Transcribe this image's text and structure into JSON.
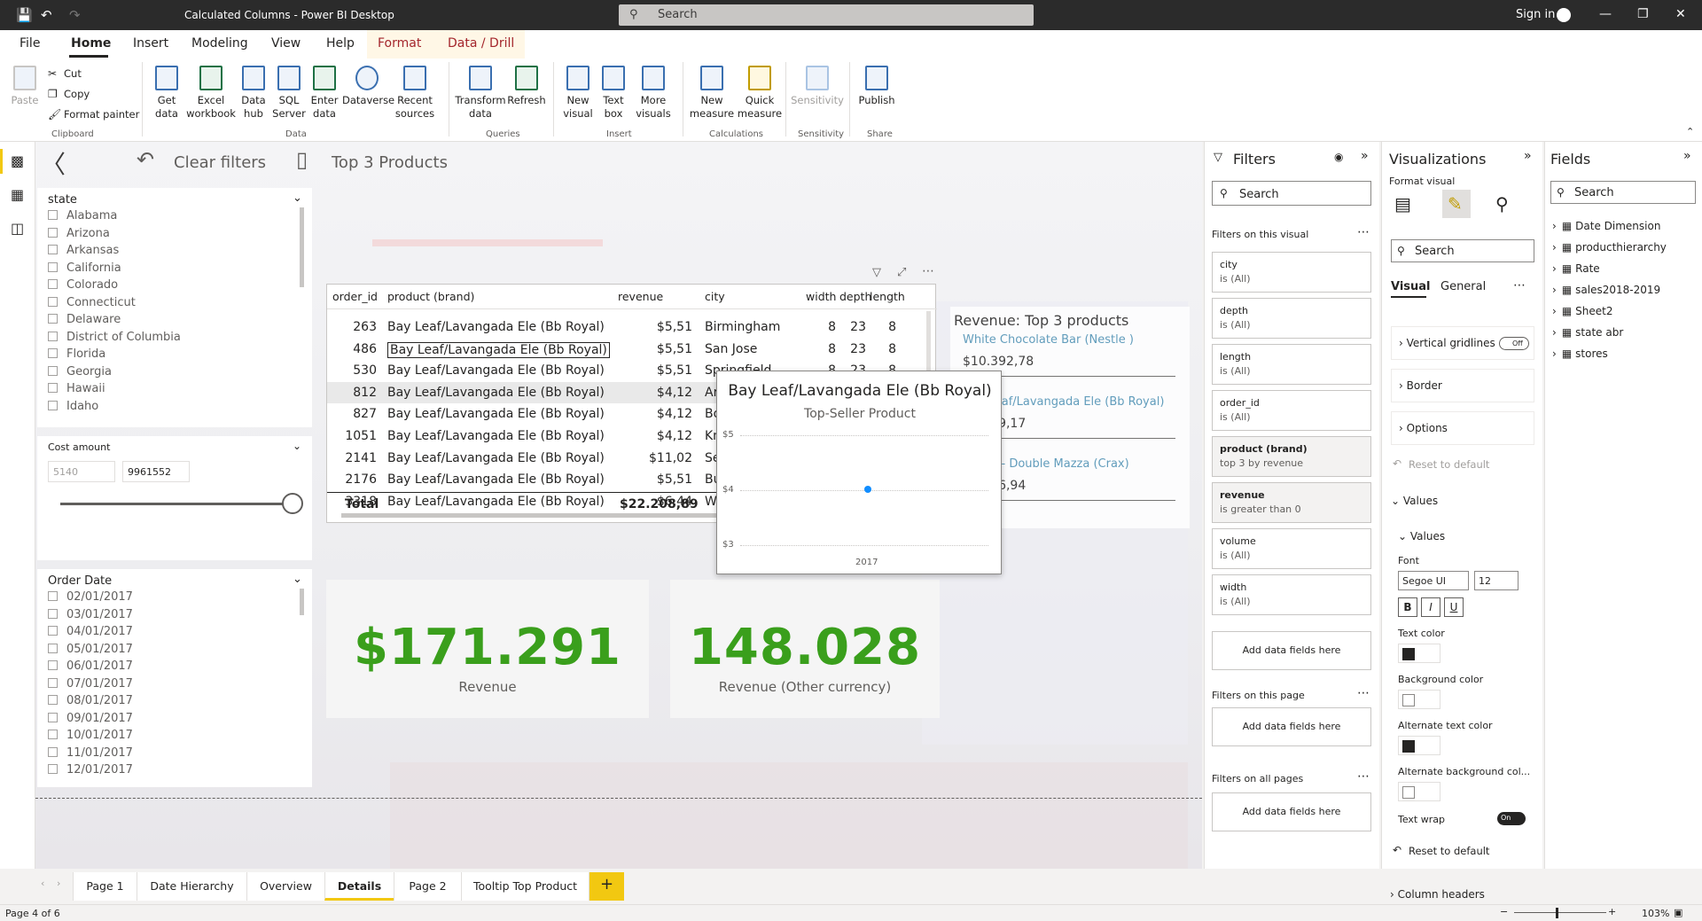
{
  "app": {
    "window_title": "Calculated Columns - Power BI Desktop",
    "search_placeholder": "Search",
    "sign_in": "Sign in"
  },
  "menu": [
    "File",
    "Home",
    "Insert",
    "Modeling",
    "View",
    "Help",
    "Format",
    "Data / Drill"
  ],
  "ribbon": {
    "clipboard": {
      "paste": "Paste",
      "cut": "Cut",
      "copy": "Copy",
      "format_painter": "Format painter",
      "group": "Clipboard"
    },
    "data": {
      "get_data": "Get data",
      "excel": "Excel workbook",
      "data_hub": "Data hub",
      "sql": "SQL Server",
      "enter_data": "Enter data",
      "dataverse": "Dataverse",
      "recent": "Recent sources",
      "group": "Data"
    },
    "queries": {
      "transform": "Transform data",
      "refresh": "Refresh",
      "group": "Queries"
    },
    "insert": {
      "new_visual": "New visual",
      "text_box": "Text box",
      "more_visuals": "More visuals",
      "group": "Insert"
    },
    "calculations": {
      "new_measure": "New measure",
      "quick_measure": "Quick measure",
      "group": "Calculations"
    },
    "sensitivity": {
      "label": "Sensitivity",
      "group": "Sensitivity"
    },
    "share": {
      "publish": "Publish",
      "group": "Share"
    }
  },
  "canvas": {
    "clear_filters": "Clear filters",
    "bookmark_label": "Top 3 Products",
    "state_slicer": {
      "title": "state",
      "items": [
        "Alabama",
        "Arizona",
        "Arkansas",
        "California",
        "Colorado",
        "Connecticut",
        "Delaware",
        "District of Columbia",
        "Florida",
        "Georgia",
        "Hawaii",
        "Idaho"
      ]
    },
    "cost_slicer": {
      "title": "Cost amount",
      "min": "5140",
      "max": "9961552"
    },
    "date_slicer": {
      "title": "Order Date",
      "items": [
        "02/01/2017",
        "03/01/2017",
        "04/01/2017",
        "05/01/2017",
        "06/01/2017",
        "07/01/2017",
        "08/01/2017",
        "09/01/2017",
        "10/01/2017",
        "11/01/2017",
        "12/01/2017"
      ]
    },
    "table": {
      "headers": [
        "order_id",
        "product (brand)",
        "revenue",
        "city",
        "width",
        "depth",
        "length"
      ],
      "rows": [
        [
          "263",
          "Bay Leaf/Lavangada Ele (Bb Royal)",
          "$5,51",
          "Birmingham",
          "8",
          "23",
          "8"
        ],
        [
          "486",
          "Bay Leaf/Lavangada Ele (Bb Royal)",
          "$5,51",
          "San Jose",
          "8",
          "23",
          "8"
        ],
        [
          "530",
          "Bay Leaf/Lavangada Ele (Bb Royal)",
          "$5,51",
          "Springfield",
          "8",
          "23",
          "8"
        ],
        [
          "812",
          "Bay Leaf/Lavangada Ele (Bb Royal)",
          "$4,12",
          "Arlington",
          "",
          "",
          ""
        ],
        [
          "827",
          "Bay Leaf/Lavangada Ele (Bb Royal)",
          "$4,12",
          "Boston",
          "",
          "",
          ""
        ],
        [
          "1051",
          "Bay Leaf/Lavangada Ele (Bb Royal)",
          "$4,12",
          "Knoxville",
          "",
          "",
          ""
        ],
        [
          "2141",
          "Bay Leaf/Lavangada Ele (Bb Royal)",
          "$11,02",
          "Seattle",
          "",
          "",
          ""
        ],
        [
          "2176",
          "Bay Leaf/Lavangada Ele (Bb Royal)",
          "$5,51",
          "Buffalo",
          "",
          "",
          ""
        ],
        [
          "3318",
          "Bay Leaf/Lavangada Ele (Bb Royal)",
          "$6,44",
          "Wichita",
          "",
          "",
          ""
        ]
      ],
      "total_label": "Total",
      "total_value": "$22.208,89"
    },
    "top3": {
      "title": "Revenue: Top 3 products",
      "items": [
        {
          "name": "White Chocolate Bar (Nestle )",
          "value": "$10.392,78"
        },
        {
          "name": "Bay Leaf/Lavangada Ele (Bb Royal)",
          "value": "$9.109,17"
        },
        {
          "name": "Green - Double Mazza (Crax)",
          "value": "$6.776,94"
        }
      ]
    },
    "tooltip": {
      "title": "Bay Leaf/Lavangada Ele (Bb Royal)",
      "subtitle": "Top-Seller Product",
      "y_ticks": [
        "$5",
        "$4",
        "$3"
      ],
      "x_tick": "2017"
    },
    "kpi1": {
      "value": "$171.291",
      "label": "Revenue"
    },
    "kpi2": {
      "value": "148.028",
      "label": "Revenue (Other currency)"
    }
  },
  "filters": {
    "title": "Filters",
    "search": "Search",
    "on_visual": "Filters on this visual",
    "cards": [
      {
        "name": "city",
        "state": "is (All)"
      },
      {
        "name": "depth",
        "state": "is (All)"
      },
      {
        "name": "length",
        "state": "is (All)"
      },
      {
        "name": "order_id",
        "state": "is (All)"
      },
      {
        "name": "product (brand)",
        "state": "top 3 by revenue"
      },
      {
        "name": "revenue",
        "state": "is greater than 0"
      },
      {
        "name": "volume",
        "state": "is (All)"
      },
      {
        "name": "width",
        "state": "is (All)"
      }
    ],
    "add_here": "Add data fields here",
    "on_page": "Filters on this page",
    "on_all": "Filters on all pages"
  },
  "viz": {
    "title": "Visualizations",
    "format_visual": "Format visual",
    "search": "Search",
    "tab_visual": "Visual",
    "tab_general": "General",
    "vertical_gridlines": "Vertical gridlines",
    "off": "Off",
    "border": "Border",
    "options": "Options",
    "reset": "Reset to default",
    "values_section": "Values",
    "values_sub": "Values",
    "font": "Font",
    "font_name": "Segoe UI",
    "font_size": "12",
    "text_color": "Text color",
    "bg_color": "Background color",
    "alt_text_color": "Alternate text color",
    "alt_bg_color": "Alternate background col...",
    "text_wrap": "Text wrap",
    "on": "On",
    "reset2": "Reset to default",
    "column_headers": "Column headers"
  },
  "fields": {
    "title": "Fields",
    "search": "Search",
    "items": [
      "Date Dimension",
      "producthierarchy",
      "Rate",
      "sales2018-2019",
      "Sheet2",
      "state abr",
      "stores"
    ]
  },
  "pages": [
    "Page 1",
    "Date Hierarchy",
    "Overview",
    "Details",
    "Page 2",
    "Tooltip Top Product"
  ],
  "status": {
    "page": "Page 4 of 6",
    "zoom": "103%"
  }
}
